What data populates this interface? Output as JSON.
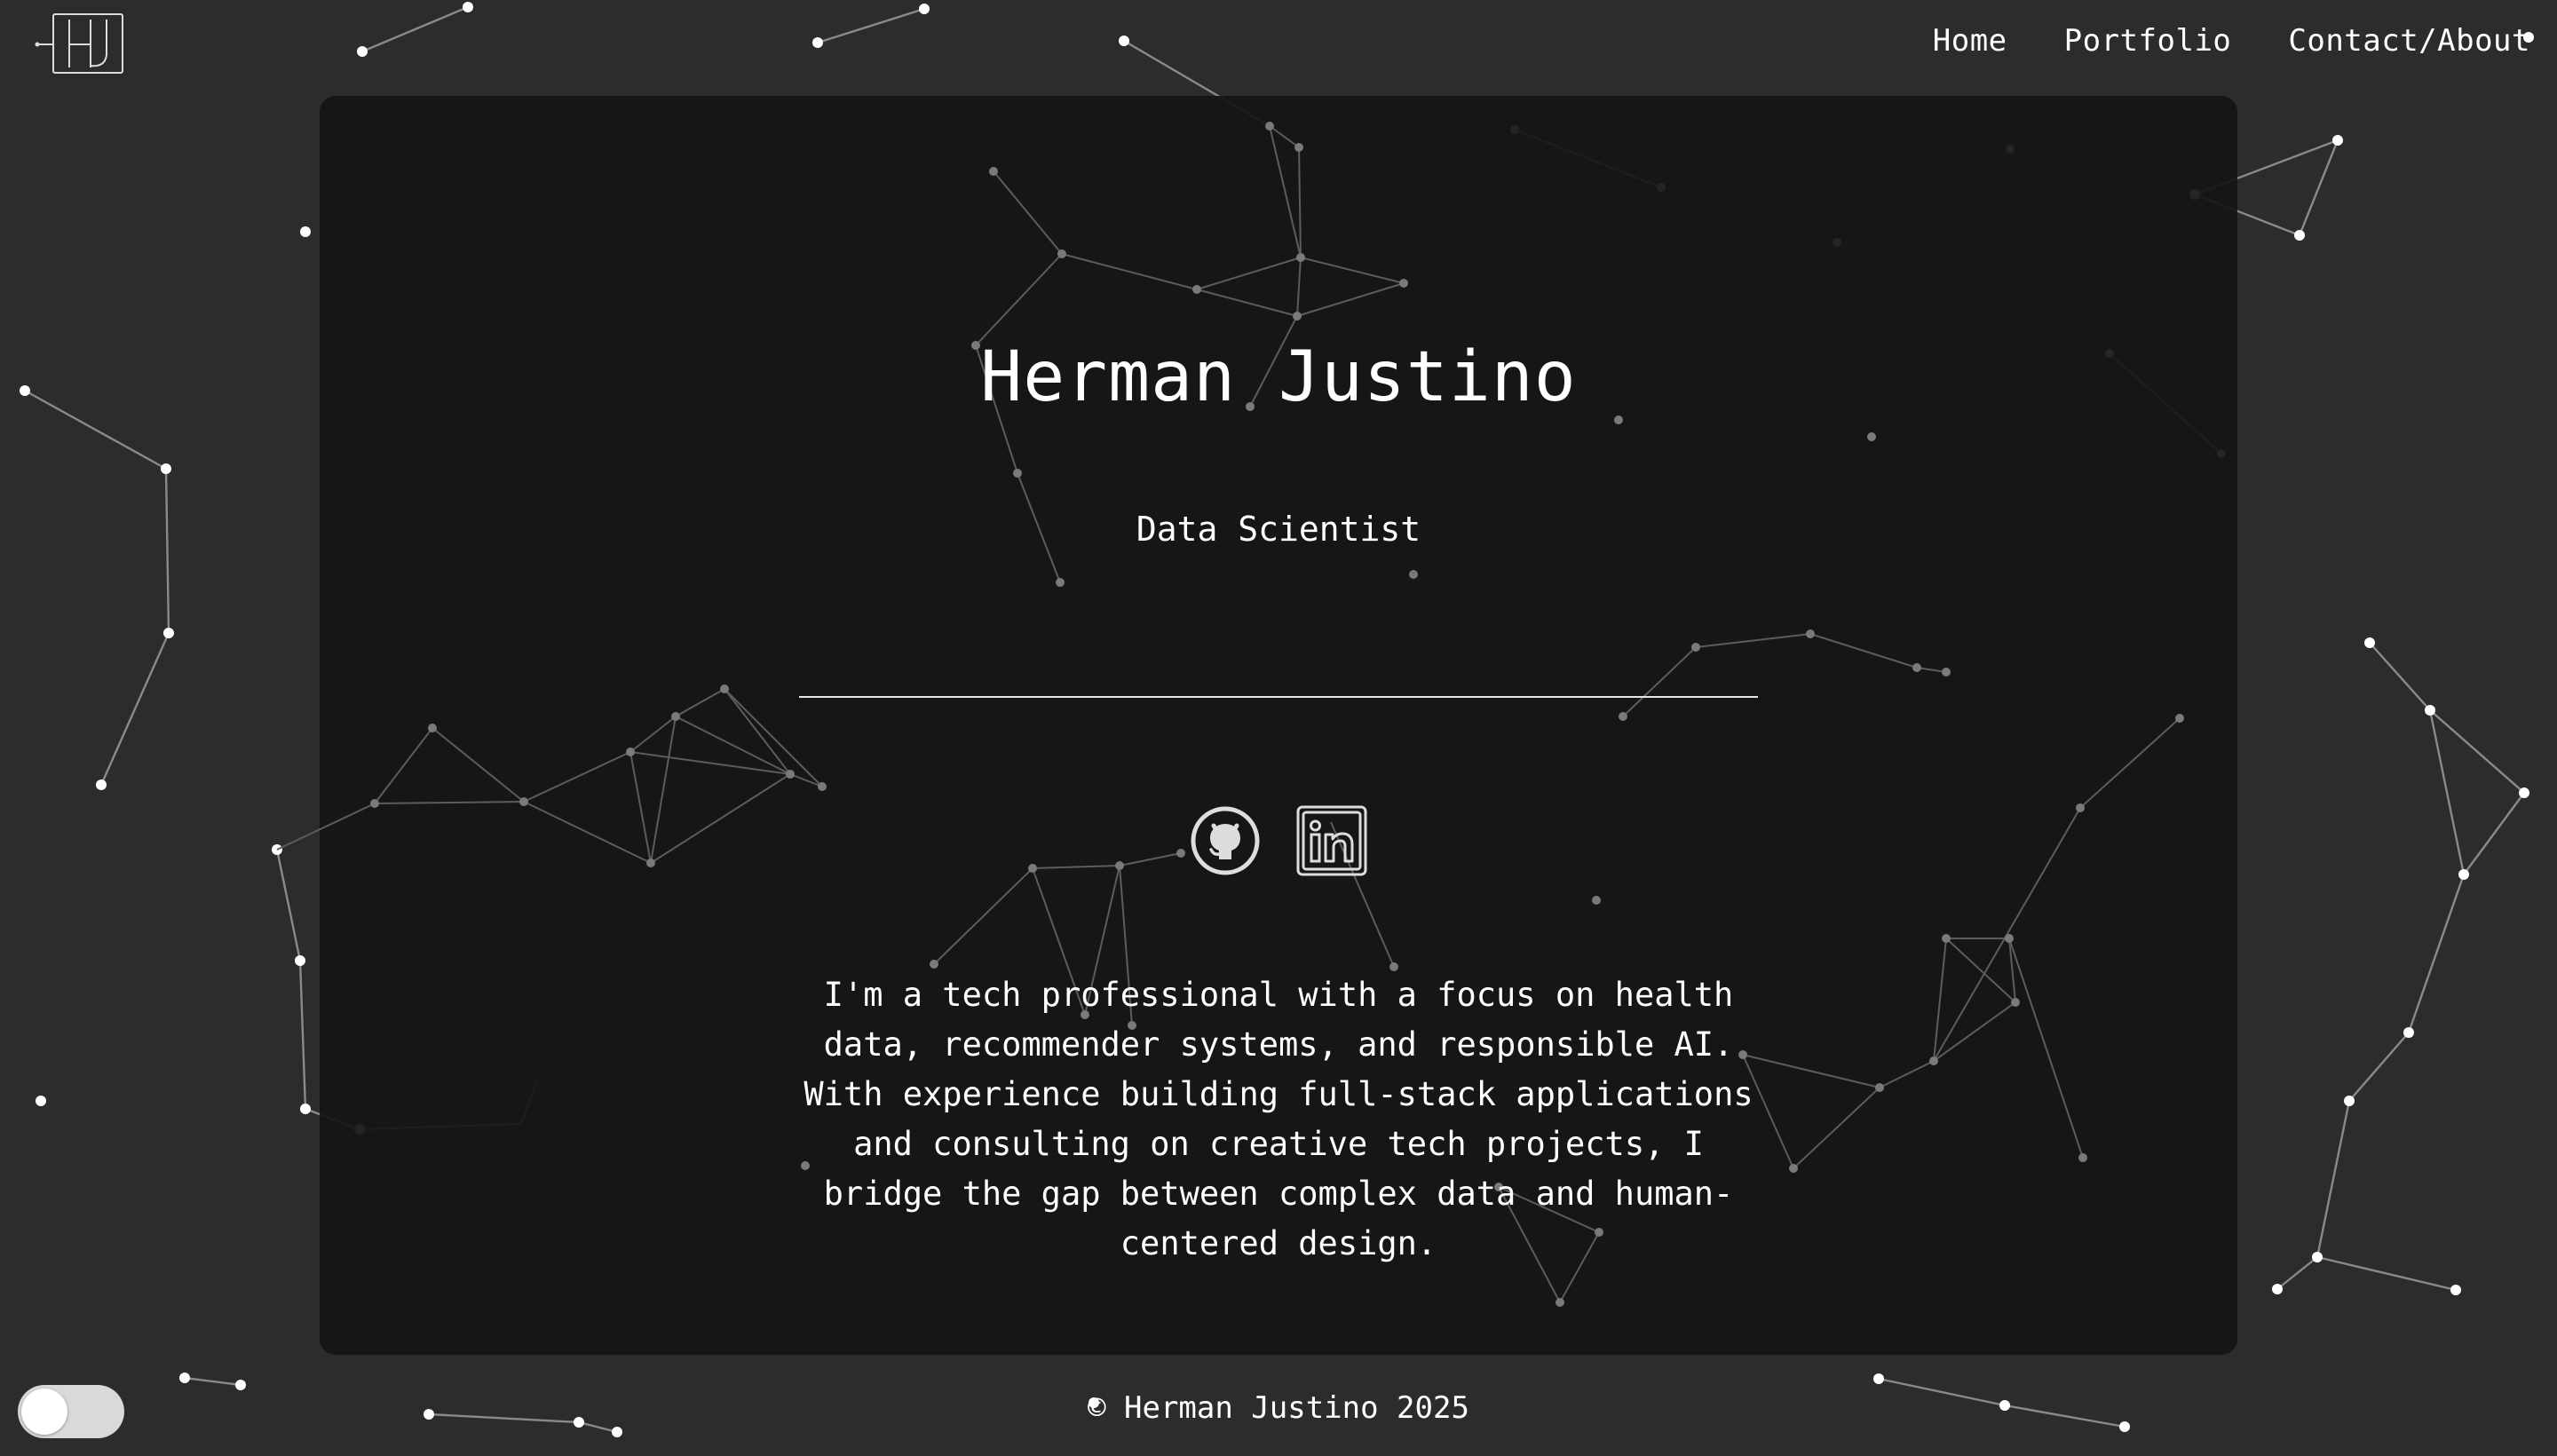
{
  "site": {
    "logo_label": "HJ logo"
  },
  "nav": {
    "items": [
      {
        "label": "Home"
      },
      {
        "label": "Portfolio"
      },
      {
        "label": "Contact/About"
      }
    ]
  },
  "hero": {
    "name": "Herman Justino",
    "subtitle": "Data Scientist",
    "bio": "I'm a tech professional with a focus on health data, recommender systems, and responsible AI. With experience building full-stack applications and consulting on creative tech projects, I bridge the gap between complex data and human-centered design."
  },
  "socials": {
    "items": [
      {
        "icon": "github-icon"
      },
      {
        "icon": "linkedin-icon"
      }
    ]
  },
  "footer": {
    "copyright": "© Herman Justino 2025"
  },
  "theme_toggle": {
    "state": "off"
  },
  "colors": {
    "page_background": "#2c2c2c",
    "card_background": "#141414",
    "text": "#ffffff",
    "node": "#ffffff",
    "edge": "#8a8a8a"
  }
}
